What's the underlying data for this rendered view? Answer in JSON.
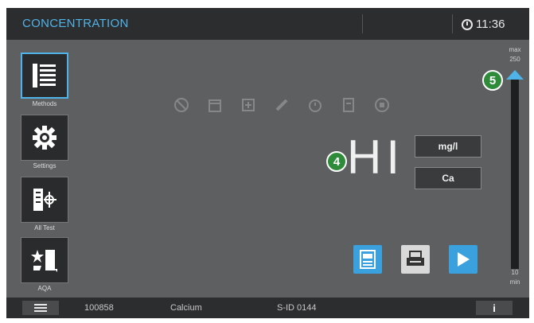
{
  "header": {
    "title": "CONCENTRATION",
    "time": "11:36"
  },
  "sidebar": {
    "items": [
      {
        "label": "Methods",
        "icon": "methods-list-icon",
        "active": true
      },
      {
        "label": "Settings",
        "icon": "gear-icon",
        "active": false
      },
      {
        "label": "All Test",
        "icon": "all-tests-icon",
        "active": false
      },
      {
        "label": "AQA",
        "icon": "aqa-star-icon",
        "active": false
      }
    ]
  },
  "main": {
    "reading": "HI",
    "unit_label": "mg/l",
    "form_label": "Ca",
    "callout_reading": "4",
    "callout_scale": "5",
    "faded_icons": [
      "dilution-icon",
      "calendar-icon",
      "add-icon",
      "pipette-icon",
      "timer-icon",
      "document-icon",
      "print-icon"
    ]
  },
  "scale": {
    "max_label": "max",
    "max_value": "250",
    "min_value": "10",
    "min_label": "min"
  },
  "actions": [
    {
      "name": "save-button",
      "icon": "save-icon",
      "color": "#3aa0de"
    },
    {
      "name": "print-button",
      "icon": "printer-icon",
      "color": "#d9d9d9"
    },
    {
      "name": "start-button",
      "icon": "play-icon",
      "color": "#3aa0de"
    }
  ],
  "status": {
    "method_number": "100858",
    "parameter": "Calcium",
    "sample_id": "S-ID 0144",
    "info_label": "i"
  },
  "colors": {
    "accent": "#4fb3e8",
    "callout": "#2e8b3a",
    "background": "#5d5f61",
    "bar": "#2c2d2f"
  }
}
